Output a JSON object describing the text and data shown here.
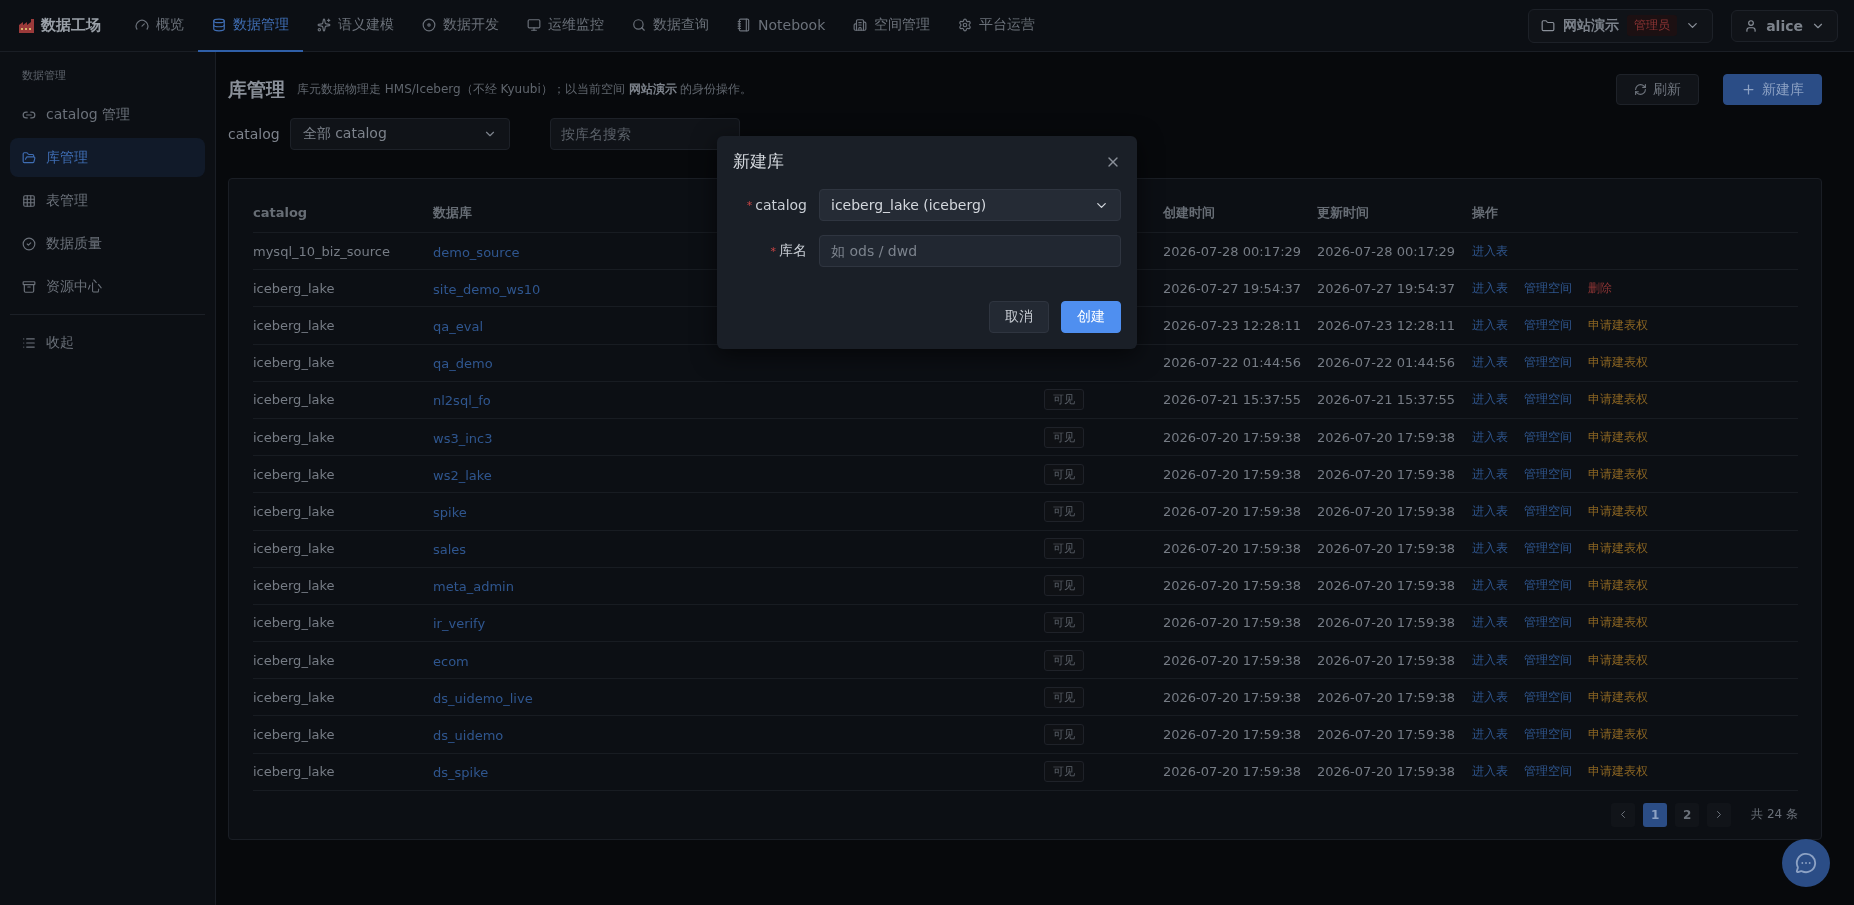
{
  "app": {
    "name": "数据工场"
  },
  "nav": [
    {
      "label": "概览",
      "selected": false
    },
    {
      "label": "数据管理",
      "selected": true
    },
    {
      "label": "语义建模",
      "selected": false
    },
    {
      "label": "数据开发",
      "selected": false
    },
    {
      "label": "运维监控",
      "selected": false
    },
    {
      "label": "数据查询",
      "selected": false
    },
    {
      "label": "Notebook",
      "selected": false
    },
    {
      "label": "空间管理",
      "selected": false
    },
    {
      "label": "平台运营",
      "selected": false
    }
  ],
  "workspace": {
    "name": "网站演示",
    "role": "管理员"
  },
  "user": {
    "name": "alice"
  },
  "sidebar": {
    "section": "数据管理",
    "items": [
      {
        "label": "catalog 管理",
        "selected": false
      },
      {
        "label": "库管理",
        "selected": true
      },
      {
        "label": "表管理",
        "selected": false
      },
      {
        "label": "数据质量",
        "selected": false
      },
      {
        "label": "资源中心",
        "selected": false
      }
    ],
    "collapse": "收起"
  },
  "page": {
    "title": "库管理",
    "description": "库元数据物理走 HMS/Iceberg（不经 Kyuubi）；以当前空间 **网站演示** 的身份操作。",
    "refresh": "刷新",
    "create": "新建库"
  },
  "filters": {
    "catalog_label": "catalog",
    "catalog_value": "全部 catalog",
    "search_placeholder": "按库名搜索"
  },
  "table": {
    "columns": [
      "catalog",
      "数据库",
      "",
      "创建时间",
      "更新时间",
      "操作"
    ],
    "rows": [
      {
        "catalog": "mysql_10_biz_source",
        "database": "demo_source",
        "created": "2026-07-28 00:17:29",
        "updated": "2026-07-28 00:17:29",
        "actions": [
          {
            "label": "进入表",
            "kind": "link"
          }
        ]
      },
      {
        "catalog": "iceberg_lake",
        "database": "site_demo_ws10",
        "created": "2026-07-27 19:54:37",
        "updated": "2026-07-27 19:54:37",
        "actions": [
          {
            "label": "进入表",
            "kind": "link"
          },
          {
            "label": "管理空间",
            "kind": "link"
          },
          {
            "label": "删除",
            "kind": "danger"
          }
        ]
      },
      {
        "catalog": "iceberg_lake",
        "database": "qa_eval",
        "created": "2026-07-23 12:28:11",
        "updated": "2026-07-23 12:28:11",
        "actions": [
          {
            "label": "进入表",
            "kind": "link"
          },
          {
            "label": "管理空间",
            "kind": "link"
          },
          {
            "label": "申请建表权",
            "kind": "warning"
          }
        ]
      },
      {
        "catalog": "iceberg_lake",
        "database": "qa_demo",
        "created": "2026-07-22 01:44:56",
        "updated": "2026-07-22 01:44:56",
        "actions": [
          {
            "label": "进入表",
            "kind": "link"
          },
          {
            "label": "管理空间",
            "kind": "link"
          },
          {
            "label": "申请建表权",
            "kind": "warning"
          }
        ]
      },
      {
        "catalog": "iceberg_lake",
        "database": "nl2sql_fo",
        "visibility": "可见",
        "created": "2026-07-21 15:37:55",
        "updated": "2026-07-21 15:37:55",
        "actions": [
          {
            "label": "进入表",
            "kind": "link"
          },
          {
            "label": "管理空间",
            "kind": "link"
          },
          {
            "label": "申请建表权",
            "kind": "warning"
          }
        ]
      },
      {
        "catalog": "iceberg_lake",
        "database": "ws3_inc3",
        "visibility": "可见",
        "created": "2026-07-20 17:59:38",
        "updated": "2026-07-20 17:59:38",
        "actions": [
          {
            "label": "进入表",
            "kind": "link"
          },
          {
            "label": "管理空间",
            "kind": "link"
          },
          {
            "label": "申请建表权",
            "kind": "warning"
          }
        ]
      },
      {
        "catalog": "iceberg_lake",
        "database": "ws2_lake",
        "visibility": "可见",
        "created": "2026-07-20 17:59:38",
        "updated": "2026-07-20 17:59:38",
        "actions": [
          {
            "label": "进入表",
            "kind": "link"
          },
          {
            "label": "管理空间",
            "kind": "link"
          },
          {
            "label": "申请建表权",
            "kind": "warning"
          }
        ]
      },
      {
        "catalog": "iceberg_lake",
        "database": "spike",
        "visibility": "可见",
        "created": "2026-07-20 17:59:38",
        "updated": "2026-07-20 17:59:38",
        "actions": [
          {
            "label": "进入表",
            "kind": "link"
          },
          {
            "label": "管理空间",
            "kind": "link"
          },
          {
            "label": "申请建表权",
            "kind": "warning"
          }
        ]
      },
      {
        "catalog": "iceberg_lake",
        "database": "sales",
        "visibility": "可见",
        "created": "2026-07-20 17:59:38",
        "updated": "2026-07-20 17:59:38",
        "actions": [
          {
            "label": "进入表",
            "kind": "link"
          },
          {
            "label": "管理空间",
            "kind": "link"
          },
          {
            "label": "申请建表权",
            "kind": "warning"
          }
        ]
      },
      {
        "catalog": "iceberg_lake",
        "database": "meta_admin",
        "visibility": "可见",
        "created": "2026-07-20 17:59:38",
        "updated": "2026-07-20 17:59:38",
        "actions": [
          {
            "label": "进入表",
            "kind": "link"
          },
          {
            "label": "管理空间",
            "kind": "link"
          },
          {
            "label": "申请建表权",
            "kind": "warning"
          }
        ]
      },
      {
        "catalog": "iceberg_lake",
        "database": "ir_verify",
        "visibility": "可见",
        "created": "2026-07-20 17:59:38",
        "updated": "2026-07-20 17:59:38",
        "actions": [
          {
            "label": "进入表",
            "kind": "link"
          },
          {
            "label": "管理空间",
            "kind": "link"
          },
          {
            "label": "申请建表权",
            "kind": "warning"
          }
        ]
      },
      {
        "catalog": "iceberg_lake",
        "database": "ecom",
        "visibility": "可见",
        "created": "2026-07-20 17:59:38",
        "updated": "2026-07-20 17:59:38",
        "actions": [
          {
            "label": "进入表",
            "kind": "link"
          },
          {
            "label": "管理空间",
            "kind": "link"
          },
          {
            "label": "申请建表权",
            "kind": "warning"
          }
        ]
      },
      {
        "catalog": "iceberg_lake",
        "database": "ds_uidemo_live",
        "visibility": "可见",
        "created": "2026-07-20 17:59:38",
        "updated": "2026-07-20 17:59:38",
        "actions": [
          {
            "label": "进入表",
            "kind": "link"
          },
          {
            "label": "管理空间",
            "kind": "link"
          },
          {
            "label": "申请建表权",
            "kind": "warning"
          }
        ]
      },
      {
        "catalog": "iceberg_lake",
        "database": "ds_uidemo",
        "visibility": "可见",
        "created": "2026-07-20 17:59:38",
        "updated": "2026-07-20 17:59:38",
        "actions": [
          {
            "label": "进入表",
            "kind": "link"
          },
          {
            "label": "管理空间",
            "kind": "link"
          },
          {
            "label": "申请建表权",
            "kind": "warning"
          }
        ]
      },
      {
        "catalog": "iceberg_lake",
        "database": "ds_spike",
        "visibility": "可见",
        "created": "2026-07-20 17:59:38",
        "updated": "2026-07-20 17:59:38",
        "actions": [
          {
            "label": "进入表",
            "kind": "link"
          },
          {
            "label": "管理空间",
            "kind": "link"
          },
          {
            "label": "申请建表权",
            "kind": "warning"
          }
        ]
      }
    ]
  },
  "pagination": {
    "pages": [
      {
        "label": "1",
        "selected": true
      },
      {
        "label": "2",
        "selected": false
      }
    ],
    "total": "共 24 条"
  },
  "dialog": {
    "title": "新建库",
    "fields": [
      {
        "label": "catalog",
        "required_mark": "*",
        "kind": "select",
        "value": "iceberg_lake (iceberg)"
      },
      {
        "label": "库名",
        "required_mark": "*",
        "kind": "input",
        "placeholder": "如 ods / dwd"
      }
    ],
    "cancel": "取消",
    "confirm": "创建"
  }
}
